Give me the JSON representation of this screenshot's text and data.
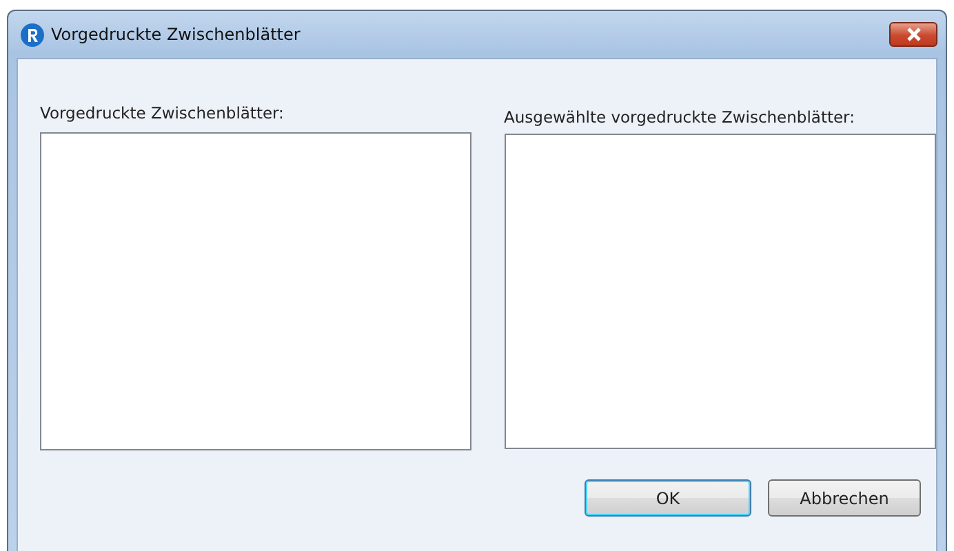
{
  "window": {
    "title": "Vorgedruckte Zwischenblätter"
  },
  "left_list": {
    "label": "Vorgedruckte Zwischenblätter:"
  },
  "right_list": {
    "label": "Ausgewählte vorgedruckte Zwischenblätter:"
  },
  "buttons": [
    {
      "label": "OK",
      "default": true
    },
    {
      "label": "Abbrechen",
      "default": false
    }
  ]
}
